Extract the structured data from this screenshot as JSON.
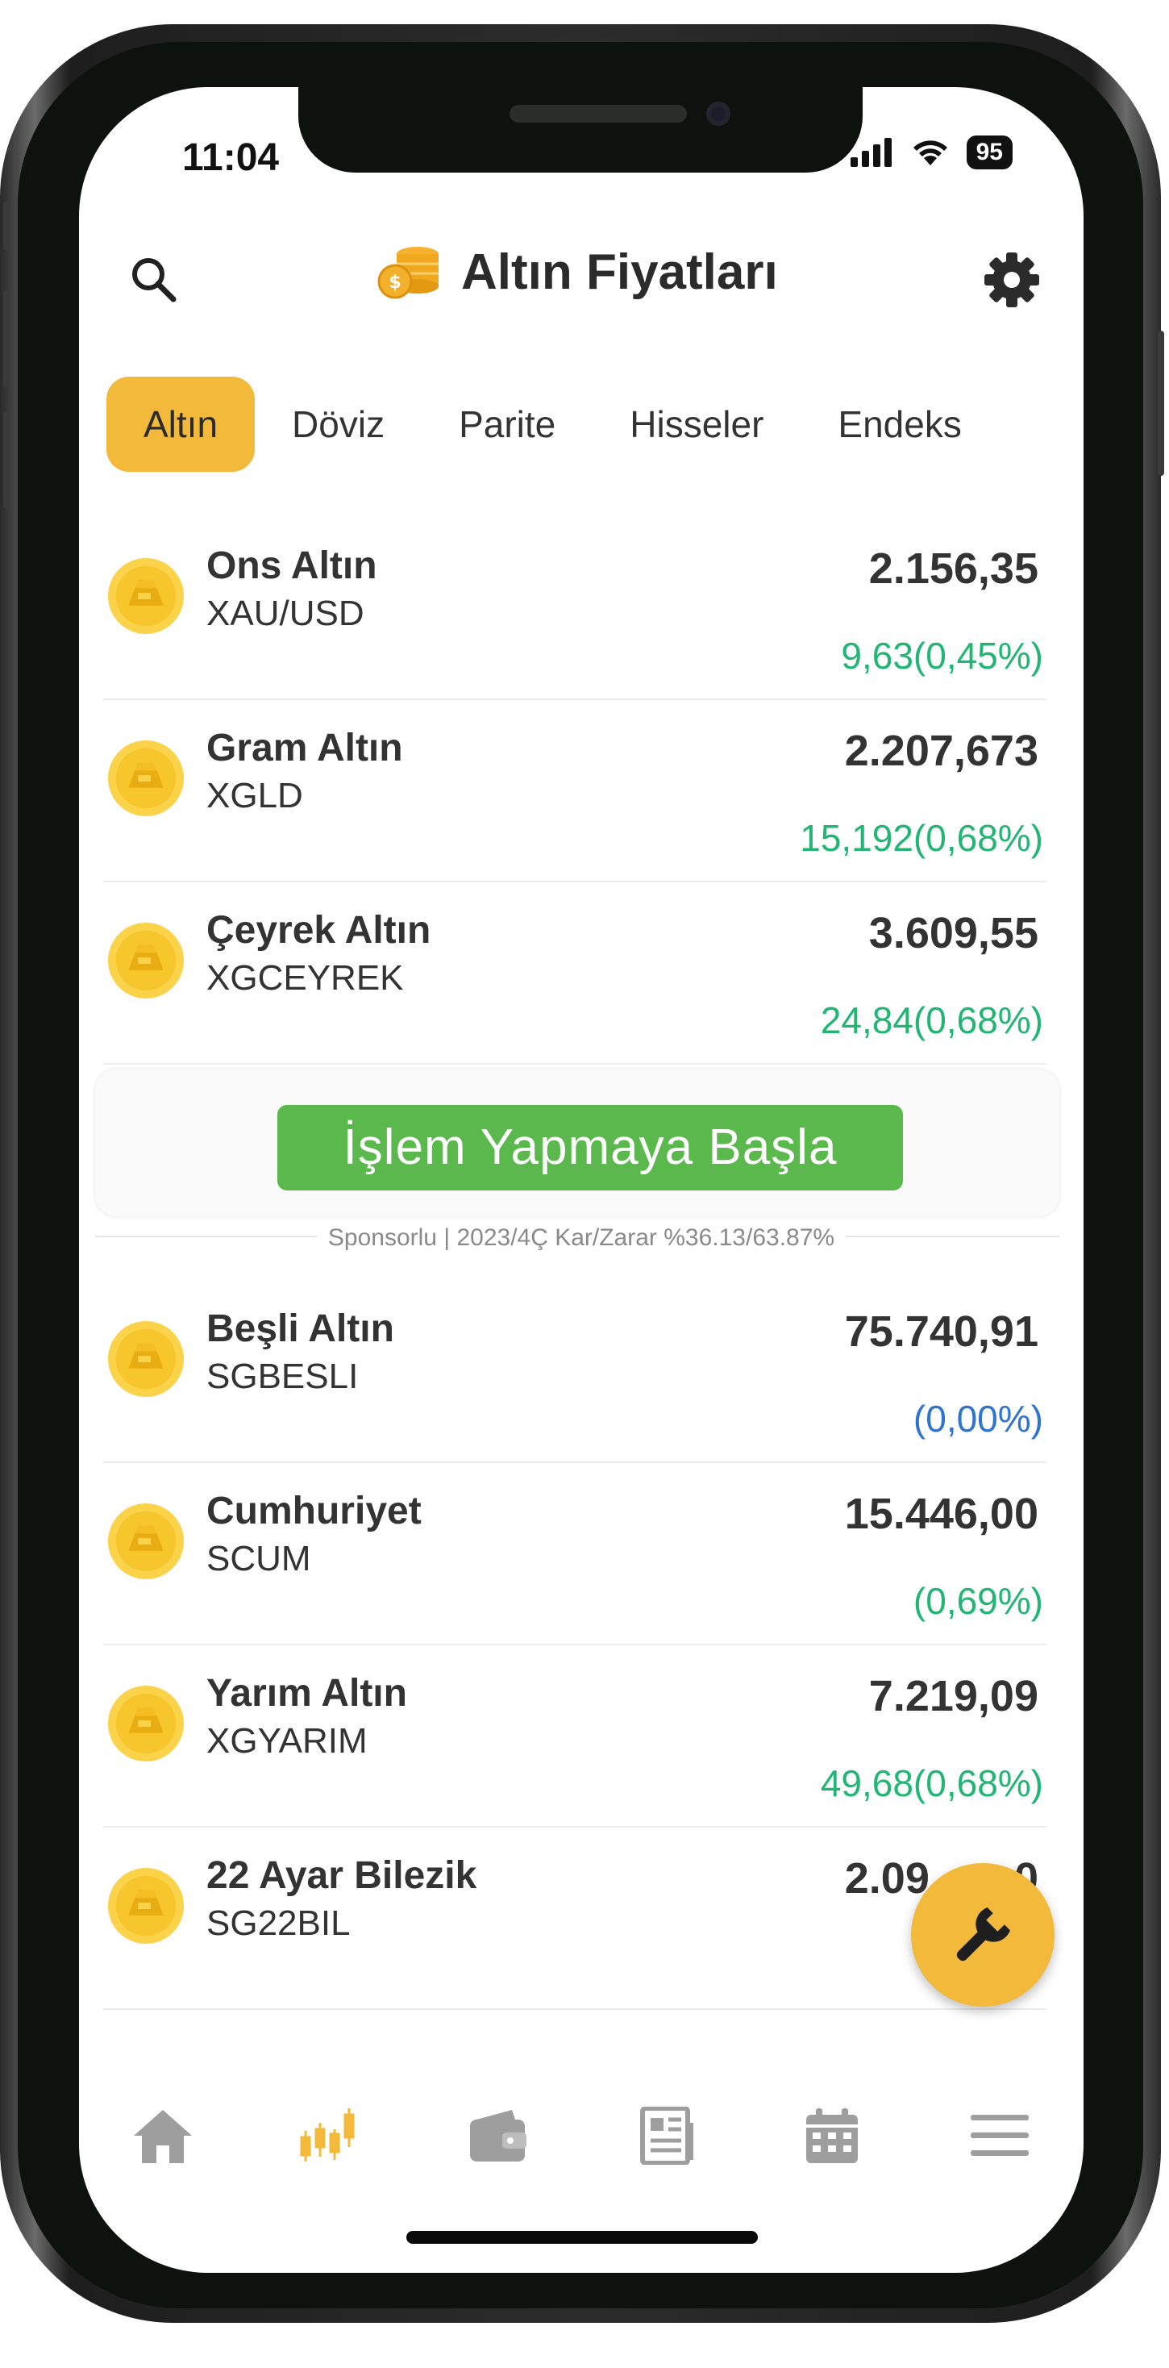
{
  "status": {
    "time": "11:04",
    "battery": "95"
  },
  "header": {
    "title": "Altın Fiyatları"
  },
  "tabs": [
    {
      "label": "Altın",
      "active": true
    },
    {
      "label": "Döviz"
    },
    {
      "label": "Parite"
    },
    {
      "label": "Hisseler"
    },
    {
      "label": "Endeks"
    }
  ],
  "rows": [
    {
      "name": "Ons Altın",
      "code": "XAU/USD",
      "price": "2.156,35",
      "change": "9,63(0,45%)",
      "trend": "up"
    },
    {
      "name": "Gram Altın",
      "code": "XGLD",
      "price": "2.207,673",
      "change": "15,192(0,68%)",
      "trend": "up"
    },
    {
      "name": "Çeyrek Altın",
      "code": "XGCEYREK",
      "price": "3.609,55",
      "change": "24,84(0,68%)",
      "trend": "up"
    },
    {
      "name": "Beşli Altın",
      "code": "SGBESLI",
      "price": "75.740,91",
      "change": "(0,00%)",
      "trend": "flat"
    },
    {
      "name": "Cumhuriyet",
      "code": "SCUM",
      "price": "15.446,00",
      "change": "(0,69%)",
      "trend": "up"
    },
    {
      "name": "Yarım Altın",
      "code": "XGYARIM",
      "price": "7.219,09",
      "change": "49,68(0,68%)",
      "trend": "up"
    },
    {
      "name": "22 Ayar Bilezik",
      "code": "SG22BIL",
      "price": "2.09__,_0",
      "change": "",
      "trend": "up"
    }
  ],
  "ad": {
    "button_label": "İşlem Yapmaya Başla",
    "sponsor_text": "Sponsorlu | 2023/4Ç Kar/Zarar %36.13/63.87%"
  },
  "colors": {
    "accent": "#f2b93b",
    "up": "#23b574",
    "flat": "#2f74d0",
    "ad_button": "#5bb84c"
  },
  "icons": {
    "search": "search-icon",
    "gear": "gear-icon",
    "coin": "gold-coin-icon",
    "coins_stack": "coins-stack-icon",
    "fab": "wrench-icon",
    "home": "home-icon",
    "chart": "candlestick-icon",
    "wallet": "wallet-icon",
    "news": "newspaper-icon",
    "calendar": "calendar-icon",
    "menu": "menu-icon"
  }
}
